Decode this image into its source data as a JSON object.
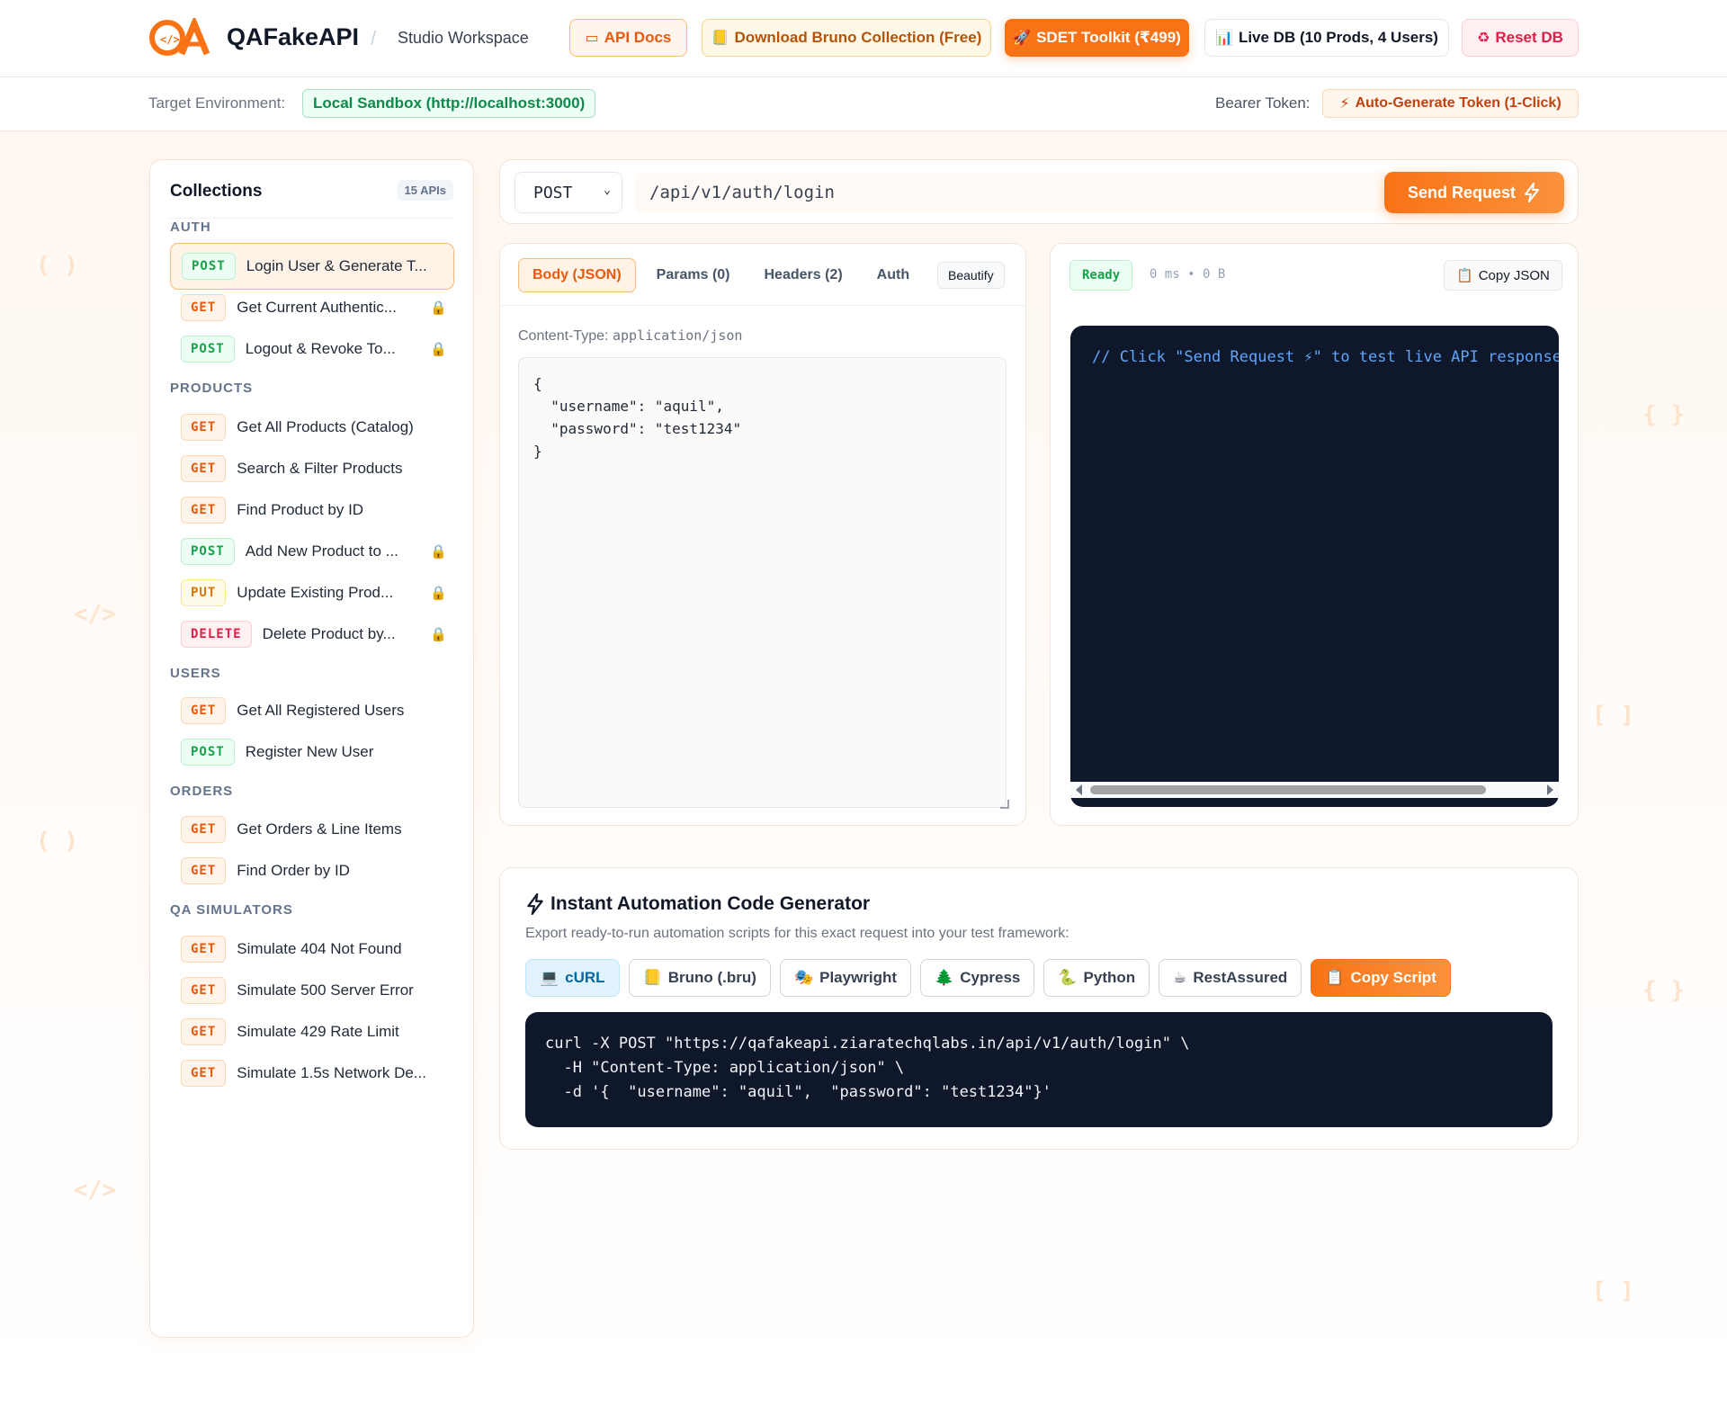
{
  "header": {
    "brand": "QAFakeAPI",
    "separator": "/",
    "workspace": "Studio Workspace",
    "buttons": {
      "api_docs": "API Docs",
      "download_bruno": "Download Bruno Collection (Free)",
      "sdet_toolkit": "SDET Toolkit (₹499)",
      "live_db": "Live DB (10 Prods, 4 Users)",
      "reset_db": "Reset DB"
    }
  },
  "env": {
    "label": "Target Environment:",
    "value": "Local Sandbox (http://localhost:3000)",
    "bearer_label": "Bearer Token:",
    "bearer_button": "Auto-Generate Token (1-Click)"
  },
  "sidebar": {
    "title": "Collections",
    "count": "15 APIs",
    "sections": [
      {
        "name": "AUTH",
        "items": [
          {
            "method": "POST",
            "label": "Login User & Generate T...",
            "locked": false,
            "active": true
          },
          {
            "method": "GET",
            "label": "Get Current Authentic...",
            "locked": true
          },
          {
            "method": "POST",
            "label": "Logout & Revoke To...",
            "locked": true
          }
        ]
      },
      {
        "name": "PRODUCTS",
        "items": [
          {
            "method": "GET",
            "label": "Get All Products (Catalog)",
            "locked": false
          },
          {
            "method": "GET",
            "label": "Search & Filter Products",
            "locked": false
          },
          {
            "method": "GET",
            "label": "Find Product by ID",
            "locked": false
          },
          {
            "method": "POST",
            "label": "Add New Product to ...",
            "locked": true
          },
          {
            "method": "PUT",
            "label": "Update Existing Prod...",
            "locked": true
          },
          {
            "method": "DELETE",
            "label": "Delete Product by...",
            "locked": true
          }
        ]
      },
      {
        "name": "USERS",
        "items": [
          {
            "method": "GET",
            "label": "Get All Registered Users",
            "locked": false
          },
          {
            "method": "POST",
            "label": "Register New User",
            "locked": false
          }
        ]
      },
      {
        "name": "ORDERS",
        "items": [
          {
            "method": "GET",
            "label": "Get Orders & Line Items",
            "locked": false
          },
          {
            "method": "GET",
            "label": "Find Order by ID",
            "locked": false
          }
        ]
      },
      {
        "name": "QA SIMULATORS",
        "items": [
          {
            "method": "GET",
            "label": "Simulate 404 Not Found",
            "locked": false
          },
          {
            "method": "GET",
            "label": "Simulate 500 Server Error",
            "locked": false
          },
          {
            "method": "GET",
            "label": "Simulate 429 Rate Limit",
            "locked": false
          },
          {
            "method": "GET",
            "label": "Simulate 1.5s Network De...",
            "locked": false
          }
        ]
      }
    ]
  },
  "request": {
    "method": "POST",
    "url": "/api/v1/auth/login",
    "send_label": "Send Request",
    "tabs": [
      "Body (JSON)",
      "Params (0)",
      "Headers (2)",
      "Auth"
    ],
    "beautify": "Beautify",
    "content_type_label": "Content-Type:",
    "content_type_value": "application/json",
    "body": "{\n  \"username\": \"aquil\",\n  \"password\": \"test1234\"\n}"
  },
  "response": {
    "status": "Ready",
    "stats": "0 ms • 0 B",
    "copy_label": "Copy JSON",
    "hint": "// Click \"Send Request ⚡\" to test live API response"
  },
  "codegen": {
    "title": "Instant Automation Code Generator",
    "subtitle": "Export ready-to-run automation scripts for this exact request into your test framework:",
    "tabs": [
      {
        "icon": "💻",
        "label": "cURL",
        "active": true
      },
      {
        "icon": "📒",
        "label": "Bruno (.bru)"
      },
      {
        "icon": "🎭",
        "label": "Playwright"
      },
      {
        "icon": "🌲",
        "label": "Cypress"
      },
      {
        "icon": "🐍",
        "label": "Python"
      },
      {
        "icon": "☕",
        "label": "RestAssured"
      }
    ],
    "copy_label": "Copy Script",
    "code": "curl -X POST \"https://qafakeapi.ziaratechqlabs.in/api/v1/auth/login\" \\\n  -H \"Content-Type: application/json\" \\\n  -d '{  \"username\": \"aquil\",  \"password\": \"test1234\"}'"
  },
  "colors": {
    "accent": "#f97316",
    "post": "#16a34a",
    "get": "#ea580c",
    "put": "#d97706",
    "delete": "#e11d48",
    "code_bg": "#0f172a"
  }
}
